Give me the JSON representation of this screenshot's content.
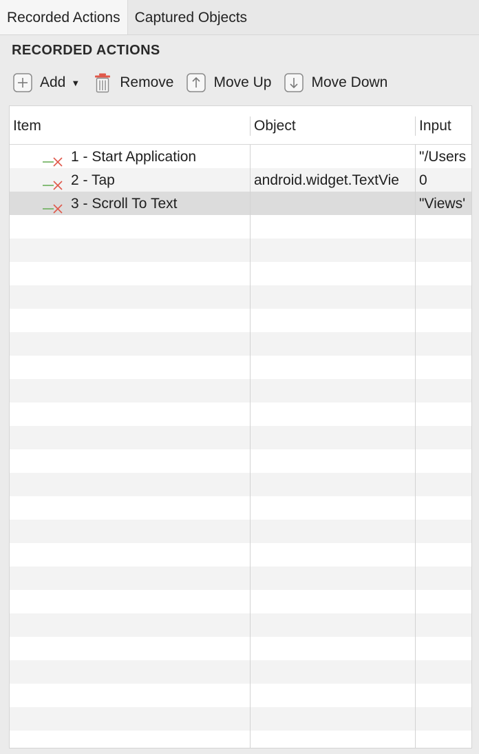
{
  "tabs": [
    {
      "label": "Recorded Actions",
      "active": true
    },
    {
      "label": "Captured Objects",
      "active": false
    }
  ],
  "section_title": "RECORDED ACTIONS",
  "toolbar": {
    "add_label": "Add",
    "remove_label": "Remove",
    "move_up_label": "Move Up",
    "move_down_label": "Move Down",
    "icons": [
      "plus-square-icon",
      "trash-icon",
      "arrow-up-square-icon",
      "arrow-down-square-icon"
    ]
  },
  "table": {
    "columns": [
      "Item",
      "Object",
      "Input"
    ],
    "rows": [
      {
        "item": "1 - Start Application",
        "object": "",
        "input": "\"/Users",
        "status_icon": "disabled-action-icon"
      },
      {
        "item": "2 - Tap",
        "object": "android.widget.TextVie",
        "input": "0",
        "status_icon": "disabled-action-icon"
      },
      {
        "item": "3 - Scroll To Text",
        "object": "",
        "input": "\"Views'",
        "status_icon": "disabled-action-icon",
        "selected": true
      }
    ]
  },
  "colors": {
    "icon_line_green": "#6aae5a",
    "icon_cross_red": "#e0584a",
    "selected_row": "#dcdcdc",
    "stripe_row": "#f3f3f3"
  }
}
